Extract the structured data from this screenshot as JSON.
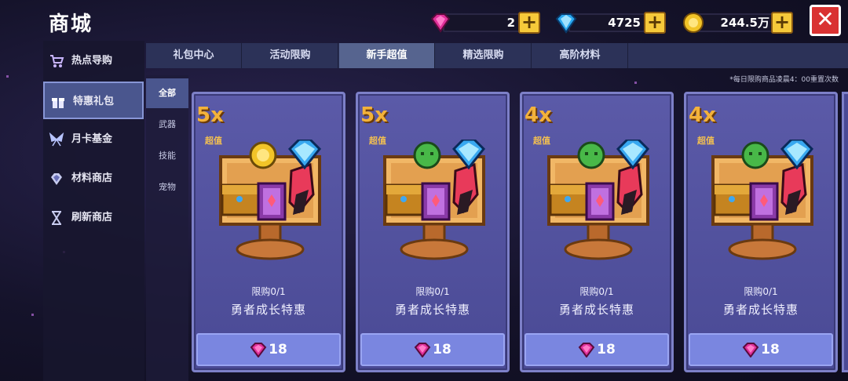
{
  "header": {
    "title": "商城",
    "close_label": "✕"
  },
  "currencies": [
    {
      "name": "pink-gem",
      "value": "2",
      "plus": "+"
    },
    {
      "name": "blue-diamond",
      "value": "4725",
      "plus": "+"
    },
    {
      "name": "gold-coin",
      "value": "244.5万",
      "plus": "+"
    }
  ],
  "sidebar": {
    "items": [
      {
        "label": "热点导购",
        "icon": "cart-icon"
      },
      {
        "label": "特惠礼包",
        "icon": "gift-icon",
        "active": true
      },
      {
        "label": "月卡基金",
        "icon": "wings-icon"
      },
      {
        "label": "材料商店",
        "icon": "gem-bag-icon"
      },
      {
        "label": "刷新商店",
        "icon": "hourglass-icon"
      }
    ]
  },
  "tabs": [
    {
      "label": "礼包中心"
    },
    {
      "label": "活动限购"
    },
    {
      "label": "新手超值",
      "active": true
    },
    {
      "label": "精选限购"
    },
    {
      "label": "高阶材料"
    }
  ],
  "subnav": [
    {
      "label": "全部",
      "active": true
    },
    {
      "label": "武器"
    },
    {
      "label": "技能"
    },
    {
      "label": "宠物"
    }
  ],
  "notice": "*每日限购商品凌晨4：00重置次数",
  "cards": [
    {
      "multiplier": "5x",
      "value_tag": "超值",
      "limit": "限购0/1",
      "name": "勇者成长特惠",
      "price": "18",
      "orb": "gold"
    },
    {
      "multiplier": "5x",
      "value_tag": "超值",
      "limit": "限购0/1",
      "name": "勇者成长特惠",
      "price": "18",
      "orb": "green"
    },
    {
      "multiplier": "4x",
      "value_tag": "超值",
      "limit": "限购0/1",
      "name": "勇者成长特惠",
      "price": "18",
      "orb": "green"
    },
    {
      "multiplier": "4x",
      "value_tag": "超值",
      "limit": "限购0/1",
      "name": "勇者成长特惠",
      "price": "18",
      "orb": "green"
    }
  ],
  "colors": {
    "accent": "#f3b23a",
    "card_bg": "#4f4f9c",
    "active_tab": "#56648f",
    "close": "#d93232"
  }
}
